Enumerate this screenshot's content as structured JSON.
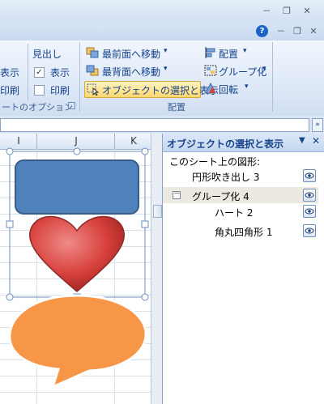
{
  "window": {
    "min_btn": "－",
    "restore_btn": "❐",
    "close_btn": "✕"
  },
  "ribbon": {
    "help": "?",
    "left_group": {
      "col1_partial_row1": "表示",
      "col1_partial_row2": "印刷",
      "col2_header": "見出し",
      "col2_show": "表示",
      "col2_print": "印刷",
      "show_checked": true,
      "print_checked": false,
      "label": "ートのオプション"
    },
    "arrange": {
      "bring_front": "最前面へ移動",
      "send_back": "最背面へ移動",
      "selection_pane": "オブジェクトの選択と表示",
      "align": "配置",
      "group": "グループ化",
      "rotate": "回転",
      "label": "配置"
    }
  },
  "sheet": {
    "columns": [
      "I",
      "J",
      "K"
    ]
  },
  "pane": {
    "title": "オブジェクトの選択と表示",
    "section_label": "このシート上の図形:",
    "items": [
      {
        "label": "円形吹き出し 3",
        "level": 0
      },
      {
        "label": "グループ化 4",
        "level": 0,
        "expander": "－"
      },
      {
        "label": "ハート 2",
        "level": 1
      },
      {
        "label": "角丸四角形 1",
        "level": 1
      }
    ]
  },
  "colors": {
    "rect_fill": "#4f81bd",
    "heart_fill": "#d7403c",
    "callout_fill": "#f79646",
    "selection_highlight": "#ffe08a"
  }
}
